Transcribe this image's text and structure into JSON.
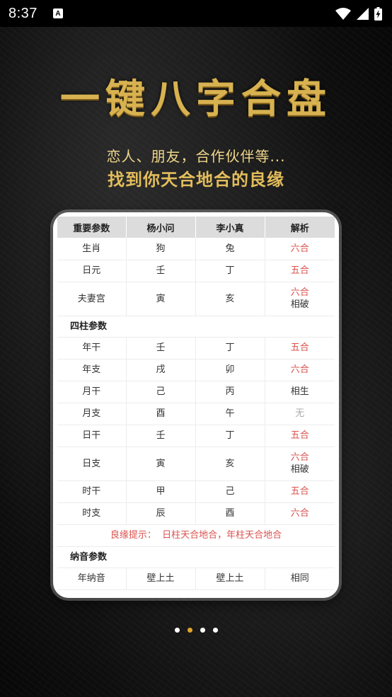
{
  "status_bar": {
    "time": "8:37",
    "notification_badge": "A",
    "icons": [
      "wifi-icon",
      "cellular-signal-icon",
      "battery-charging-icon"
    ]
  },
  "hero": {
    "title": "一键八字合盘",
    "subtitle_1": "恋人、朋友，合作伙伴等...",
    "subtitle_2": "找到你天合地合的良缘"
  },
  "colors": {
    "gold": "#d8b250",
    "red": "#d9534f",
    "header_gray": "#dcdcdc",
    "dot_active": "#e0a52a"
  },
  "table": {
    "headers": [
      "重要参数",
      "杨小问",
      "李小真",
      "解析"
    ],
    "main_rows": [
      {
        "label": "生肖",
        "a": "狗",
        "b": "兔",
        "result": [
          "六合"
        ],
        "style": "red"
      },
      {
        "label": "日元",
        "a": "壬",
        "b": "丁",
        "result": [
          "五合"
        ],
        "style": "red"
      },
      {
        "label": "夫妻宫",
        "a": "寅",
        "b": "亥",
        "result": [
          "六合",
          "相破"
        ],
        "style": "mixed"
      }
    ],
    "section_pillars": "四柱参数",
    "pillar_rows": [
      {
        "label": "年干",
        "a": "壬",
        "b": "丁",
        "result": [
          "五合"
        ],
        "style": "red"
      },
      {
        "label": "年支",
        "a": "戌",
        "b": "卯",
        "result": [
          "六合"
        ],
        "style": "red"
      },
      {
        "label": "月干",
        "a": "己",
        "b": "丙",
        "result": [
          "相生"
        ],
        "style": "normal"
      },
      {
        "label": "月支",
        "a": "酉",
        "b": "午",
        "result": [
          "无"
        ],
        "style": "gray"
      },
      {
        "label": "日干",
        "a": "壬",
        "b": "丁",
        "result": [
          "五合"
        ],
        "style": "red"
      },
      {
        "label": "日支",
        "a": "寅",
        "b": "亥",
        "result": [
          "六合",
          "相破"
        ],
        "style": "mixed"
      },
      {
        "label": "时干",
        "a": "甲",
        "b": "己",
        "result": [
          "五合"
        ],
        "style": "red"
      },
      {
        "label": "时支",
        "a": "辰",
        "b": "酉",
        "result": [
          "六合"
        ],
        "style": "red"
      }
    ],
    "tip": "良缘提示：  日柱天合地合，年柱天合地合",
    "section_nayin": "纳音参数",
    "nayin_rows": [
      {
        "label": "年纳音",
        "a": "壁上土",
        "b": "壁上土",
        "result": [
          "相同"
        ],
        "style": "normal"
      }
    ]
  },
  "pager": {
    "count": 4,
    "active_index": 1
  }
}
